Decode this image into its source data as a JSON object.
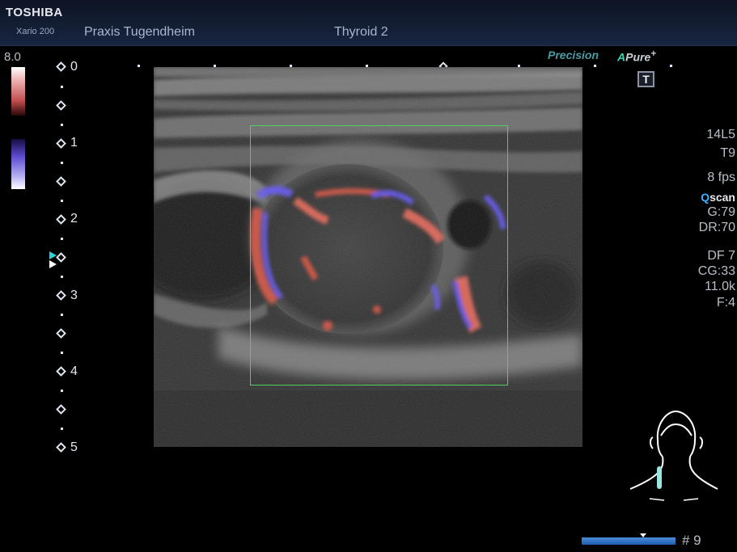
{
  "header": {
    "brand": "TOSHIBA",
    "model": "Xario 200",
    "clinic": "Praxis Tugendheim",
    "exam": "Thyroid 2"
  },
  "color_scale": {
    "max_value": "8.0",
    "positive_color": "#c04c4c",
    "negative_color": "#5c4bd0"
  },
  "depth_scale": {
    "labels": [
      "0",
      "1",
      "2",
      "3",
      "4",
      "5"
    ]
  },
  "overlays": {
    "precision_label": "Precision",
    "apure_label": "Pure",
    "apure_prefix": "A",
    "apure_suffix": "+",
    "text_mode_icon": "T"
  },
  "parameters": {
    "transducer": "14L5",
    "preset": "T9",
    "frame_rate": "8 fps",
    "qscan_prefix": "Q",
    "qscan": "scan",
    "gain": "G:79",
    "dynamic_range": "DR:70",
    "doppler_freq": "DF 7",
    "color_gain": "CG:33",
    "prf": "11.0k",
    "filter": "F:4"
  },
  "footer": {
    "frame_number": "# 9"
  },
  "icons": {
    "body_marker": "neck-body-marker-icon",
    "text_mode": "t-text-icon"
  },
  "colors": {
    "roi_box": "#4cd060",
    "accent": "#3ad2b0"
  }
}
